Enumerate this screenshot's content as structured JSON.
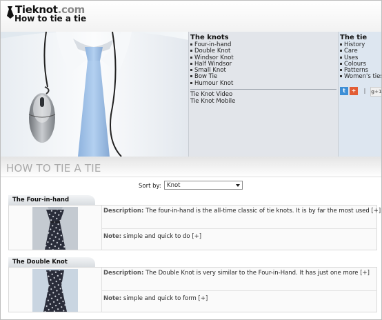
{
  "header": {
    "logo_main": "Tieknot",
    "logo_domain": ".com",
    "subtitle": "How to tie a tie"
  },
  "knots_menu": {
    "title": "The knots",
    "items": [
      "Four-in-hand",
      "Double Knot",
      "Windsor Knot",
      "Half Windsor",
      "Small Knot",
      "Bow Tie",
      "Humour Knot"
    ],
    "extra_links": [
      "Tie Knot Video",
      "Tie Knot Mobile"
    ]
  },
  "tie_menu": {
    "title": "The tie",
    "items": [
      "History",
      "Care",
      "Uses",
      "Colours",
      "Patterns",
      "Women's ties"
    ],
    "social": {
      "separator": "|",
      "google": "g+1"
    }
  },
  "page": {
    "heading": "HOW TO TIE A TIE",
    "sort_label": "Sort by:",
    "sort_value": "Knot"
  },
  "knots": [
    {
      "name": "The Four-in-hand",
      "desc_label": "Description:",
      "description": "The four-in-hand is the all-time classic of tie knots. It is by far the most used",
      "desc_more": "[+]",
      "note_label": "Note:",
      "note": "simple and quick to do",
      "note_more": "[+]"
    },
    {
      "name": "The Double Knot",
      "desc_label": "Description:",
      "description": "The Double Knot is very similar to the Four-in-Hand. It has just one more",
      "desc_more": "[+]",
      "note_label": "Note:",
      "note": "simple and quick to form",
      "note_more": "[+]"
    }
  ],
  "colors": {
    "tie_blue": "#9fc0e8",
    "knot_tie": "#2a2d3a",
    "twitter": "#3d8fd6",
    "plus": "#e25d35"
  }
}
